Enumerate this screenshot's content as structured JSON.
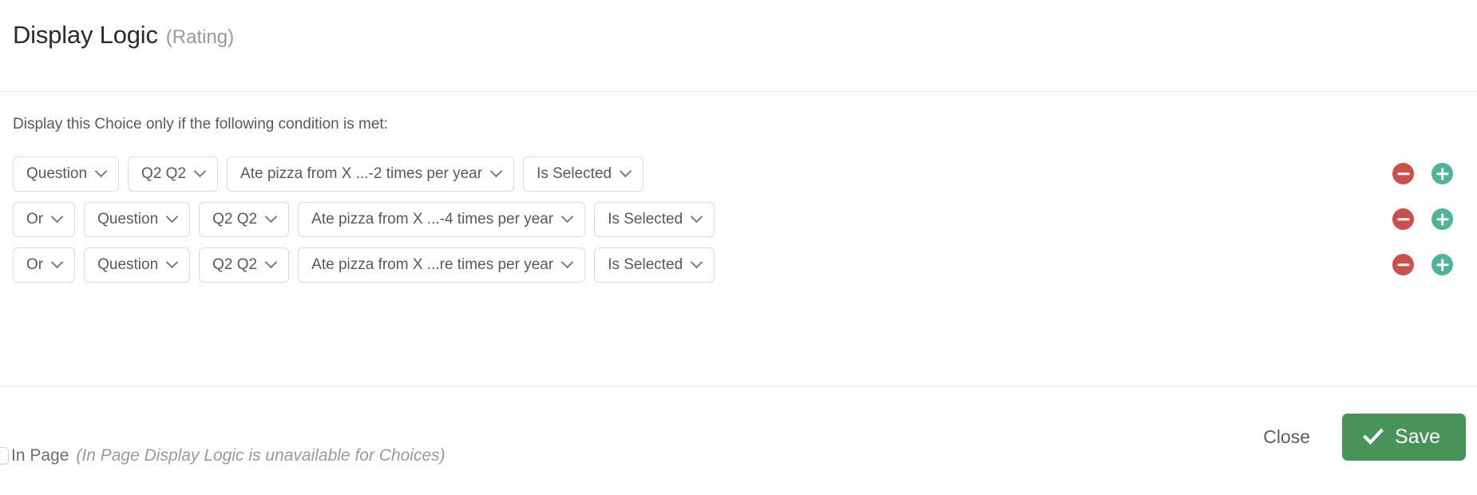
{
  "header": {
    "title": "Display Logic",
    "subtitle": "(Rating)"
  },
  "body": {
    "instruction": "Display this Choice only if the following condition is met:",
    "rows": [
      {
        "conjunction": null,
        "source_type": "Question",
        "question": "Q2 Q2",
        "choice": "Ate pizza from X ...-2 times per year",
        "operator": "Is Selected",
        "remove_icon": "minus-circle-icon",
        "add_icon": "plus-circle-icon"
      },
      {
        "conjunction": "Or",
        "source_type": "Question",
        "question": "Q2 Q2",
        "choice": "Ate pizza from X ...-4 times per year",
        "operator": "Is Selected",
        "remove_icon": "minus-circle-icon",
        "add_icon": "plus-circle-icon"
      },
      {
        "conjunction": "Or",
        "source_type": "Question",
        "question": "Q2 Q2",
        "choice": "Ate pizza from X ...re times per year",
        "operator": "Is Selected",
        "remove_icon": "minus-circle-icon",
        "add_icon": "plus-circle-icon"
      }
    ]
  },
  "footer": {
    "in_page_label": "In Page",
    "in_page_note": "(In Page Display Logic is unavailable for Choices)",
    "in_page_checked": false,
    "close_label": "Close",
    "save_label": "Save",
    "save_icon": "checkmark-icon"
  },
  "colors": {
    "save_green": "#489359",
    "add_green": "#4fb395",
    "remove_red": "#c9504b",
    "text_primary": "#58595c",
    "text_muted": "#9a9a9a",
    "border": "#dcdcdc",
    "divider": "#e6e6e6"
  }
}
